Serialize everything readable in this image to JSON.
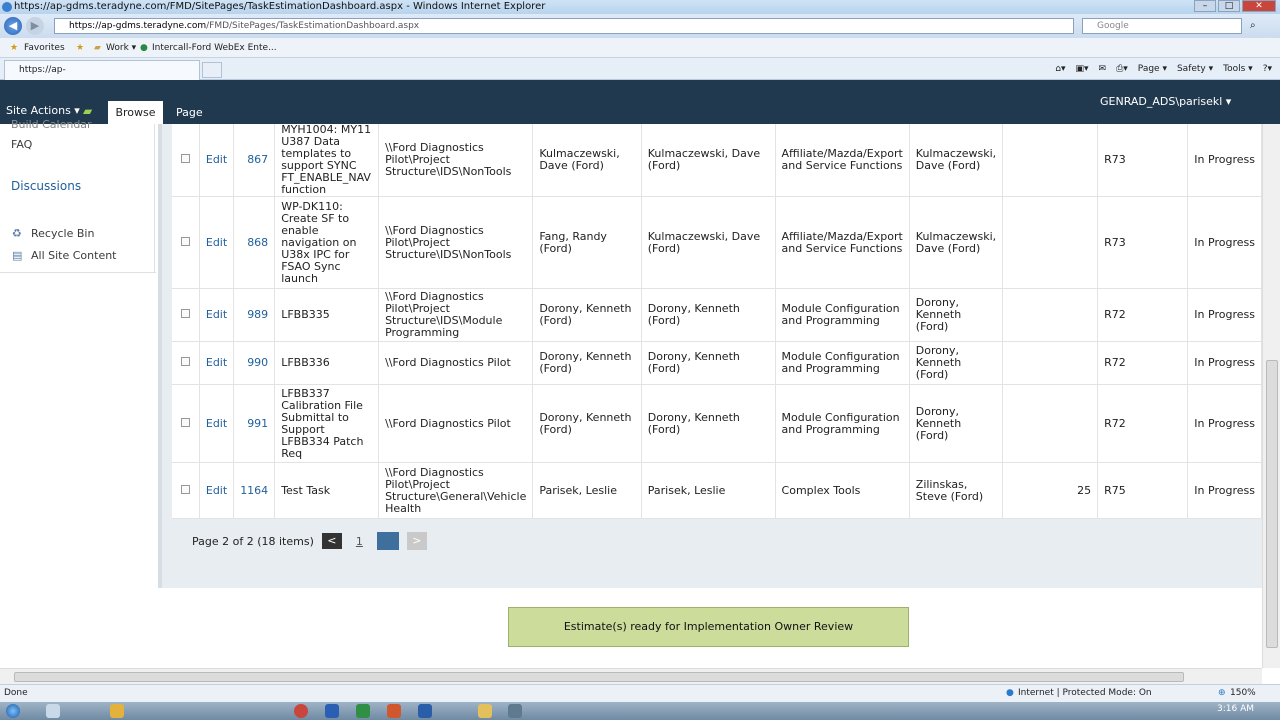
{
  "browser": {
    "window_title": "https://ap-gdms.teradyne.com/FMD/SitePages/TaskEstimationDashboard.aspx - Windows Internet Explorer",
    "address_host": "https://ap-gdms.teradyne.com",
    "address_path": "/FMD/SitePages/TaskEstimationDashboard.aspx",
    "search_placeholder": "Google",
    "favorites": [
      "Favorites",
      "Work ▾",
      "Intercall-Ford WebEx Ente..."
    ],
    "tab_label": "https://ap-gdms.teradyne.com/FMD/SitePages/...",
    "commands": [
      "Page ▾",
      "Safety ▾",
      "Tools ▾"
    ]
  },
  "ribbon": {
    "site_actions": "Site Actions ▾",
    "browse": "Browse",
    "page": "Page",
    "user": "GENRAD_ADS\\parisekl ▾"
  },
  "leftnav": {
    "partial_item": "Build Calendar",
    "faq": "FAQ",
    "discussions": "Discussions",
    "recycle_bin": "Recycle Bin",
    "all_site_content": "All Site Content"
  },
  "table": {
    "rows": [
      {
        "edit": "Edit",
        "id": "867",
        "title": "MYH1004: MY11 U387 Data templates to support SYNC FT_ENABLE_NAV function",
        "path": "\\\\Ford Diagnostics Pilot\\Project Structure\\IDS\\NonTools",
        "p1": "Kulmaczewski, Dave (Ford)",
        "p2": "Kulmaczewski, Dave (Ford)",
        "cat": "Affiliate/Mazda/Export and Service Functions",
        "p3": "Kulmaczewski, Dave (Ford)",
        "num": "",
        "rel": "R73",
        "status": "In Progress"
      },
      {
        "edit": "Edit",
        "id": "868",
        "title": "WP-DK110: Create SF to enable navigation on U38x IPC for FSAO Sync launch",
        "path": "\\\\Ford Diagnostics Pilot\\Project Structure\\IDS\\NonTools",
        "p1": "Fang, Randy (Ford)",
        "p2": "Kulmaczewski, Dave (Ford)",
        "cat": "Affiliate/Mazda/Export and Service Functions",
        "p3": "Kulmaczewski, Dave (Ford)",
        "num": "",
        "rel": "R73",
        "status": "In Progress"
      },
      {
        "edit": "Edit",
        "id": "989",
        "title": "LFBB335",
        "path": "\\\\Ford Diagnostics Pilot\\Project Structure\\IDS\\Module Programming",
        "p1": "Dorony, Kenneth (Ford)",
        "p2": "Dorony, Kenneth (Ford)",
        "cat": "Module Configuration and Programming",
        "p3": "Dorony, Kenneth (Ford)",
        "num": "",
        "rel": "R72",
        "status": "In Progress"
      },
      {
        "edit": "Edit",
        "id": "990",
        "title": "LFBB336",
        "path": "\\\\Ford Diagnostics Pilot",
        "p1": "Dorony, Kenneth (Ford)",
        "p2": "Dorony, Kenneth (Ford)",
        "cat": "Module Configuration and Programming",
        "p3": "Dorony, Kenneth (Ford)",
        "num": "",
        "rel": "R72",
        "status": "In Progress"
      },
      {
        "edit": "Edit",
        "id": "991",
        "title": "LFBB337 Calibration File Submittal to Support LFBB334 Patch Req",
        "path": "\\\\Ford Diagnostics Pilot",
        "p1": "Dorony, Kenneth (Ford)",
        "p2": "Dorony, Kenneth (Ford)",
        "cat": "Module Configuration and Programming",
        "p3": "Dorony, Kenneth (Ford)",
        "num": "",
        "rel": "R72",
        "status": "In Progress"
      },
      {
        "edit": "Edit",
        "id": "1164",
        "title": "Test Task",
        "path": "\\\\Ford Diagnostics Pilot\\Project Structure\\General\\Vehicle Health",
        "p1": "Parisek, Leslie",
        "p2": "Parisek, Leslie",
        "cat": "Complex Tools",
        "p3": "Zilinskas, Steve (Ford)",
        "num": "25",
        "rel": "R75",
        "status": "In Progress"
      }
    ]
  },
  "pager": {
    "text": "Page 2 of 2 (18 items)",
    "prev": "<",
    "page1": "1",
    "next": ">"
  },
  "action_button": "Estimate(s) ready for Implementation Owner Review",
  "status": {
    "left": "Done",
    "zone": "Internet | Protected Mode: On",
    "zoom": "150%"
  },
  "taskbar": {
    "clock": "3:16 AM"
  }
}
